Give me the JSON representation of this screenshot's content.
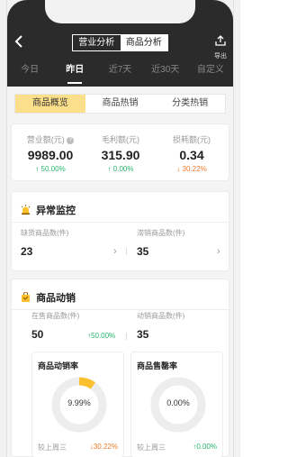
{
  "header": {
    "segments": [
      "营业分析",
      "商品分析"
    ],
    "active_segment": 1,
    "export_label": "导出",
    "date_tabs": [
      "今日",
      "昨日",
      "近7天",
      "近30天",
      "自定义"
    ],
    "active_date_tab": 1
  },
  "category_tabs": [
    "商品概览",
    "商品热销",
    "分类热销"
  ],
  "active_category_tab": 0,
  "stats": [
    {
      "label": "营业额(元)",
      "value": "9989.00",
      "delta": "50.00%",
      "direction": "up"
    },
    {
      "label": "毛利额(元)",
      "value": "315.90",
      "delta": "0.00%",
      "direction": "up"
    },
    {
      "label": "损耗额(元)",
      "value": "0.34",
      "delta": "30.22%",
      "direction": "down"
    }
  ],
  "monitor": {
    "title": "异常监控",
    "items": [
      {
        "label": "缺货商品数(件)",
        "value": "23"
      },
      {
        "label": "滞销商品数(件)",
        "value": "35"
      }
    ]
  },
  "sales": {
    "title": "商品动销",
    "items": [
      {
        "label": "在售商品数(件)",
        "value": "50",
        "delta": "50.00%",
        "direction": "up"
      },
      {
        "label": "动销商品数(件)",
        "value": "35"
      }
    ],
    "rates": [
      {
        "title": "商品动销率",
        "value_text": "9.99%",
        "value": 9.99,
        "compare_label": "较上周三",
        "delta": "30.22%",
        "direction": "down"
      },
      {
        "title": "商品售罄率",
        "value_text": "0.00%",
        "value": 0,
        "compare_label": "较上周三",
        "delta": "0.00%",
        "direction": "up"
      }
    ]
  },
  "colors": {
    "accent": "#fbc02d",
    "up": "#28b46a",
    "down": "#f07a2a",
    "header_bg": "#2b2b2b"
  }
}
